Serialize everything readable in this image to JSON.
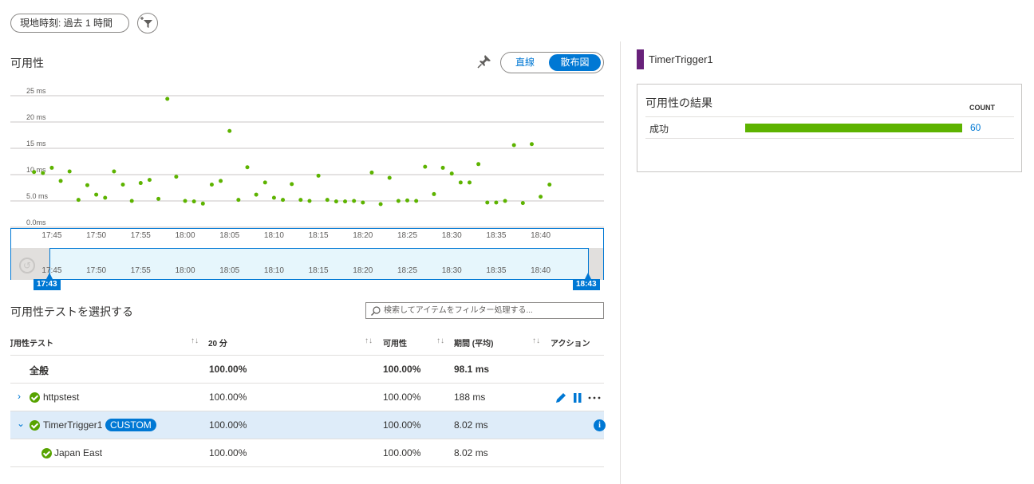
{
  "header": {
    "time_range": "現地時刻: 過去 1 時間",
    "filter_icon": "filter-add-icon"
  },
  "availability": {
    "title": "可用性",
    "pin_icon": "pin-icon",
    "toggle_line": "直線",
    "toggle_scatter": "散布図",
    "selected_view": "散布図"
  },
  "chart_data": {
    "type": "scatter",
    "title": "",
    "xlabel": "",
    "ylabel": "",
    "y_unit": "ms",
    "ylim": [
      0,
      25
    ],
    "y_ticks": [
      "25 ms",
      "20 ms",
      "15 ms",
      "10 ms",
      "5.0 ms",
      "0.0ms"
    ],
    "x_ticks": [
      "17:45",
      "17:50",
      "17:55",
      "18:00",
      "18:05",
      "18:10",
      "18:15",
      "18:20",
      "18:25",
      "18:30",
      "18:35",
      "18:40"
    ],
    "xlim": [
      "17:42",
      "18:44"
    ],
    "grid": true,
    "color": "#5db300",
    "x": [
      "17:43",
      "17:44",
      "17:45",
      "17:46",
      "17:47",
      "17:48",
      "17:49",
      "17:50",
      "17:51",
      "17:52",
      "17:53",
      "17:54",
      "17:55",
      "17:56",
      "17:57",
      "17:58",
      "17:59",
      "18:00",
      "18:01",
      "18:02",
      "18:03",
      "18:04",
      "18:05",
      "18:06",
      "18:07",
      "18:08",
      "18:09",
      "18:10",
      "18:11",
      "18:12",
      "18:13",
      "18:14",
      "18:15",
      "18:16",
      "18:17",
      "18:18",
      "18:19",
      "18:20",
      "18:21",
      "18:22",
      "18:23",
      "18:24",
      "18:25",
      "18:26",
      "18:27",
      "18:28",
      "18:29",
      "18:30",
      "18:31",
      "18:32",
      "18:33",
      "18:34",
      "18:35",
      "18:36",
      "18:37",
      "18:38",
      "18:39",
      "18:40",
      "18:41"
    ],
    "y": [
      10.5,
      10.3,
      11.3,
      8.8,
      10.6,
      5.2,
      8.0,
      6.2,
      5.6,
      10.6,
      8.1,
      5.0,
      8.4,
      9.0,
      5.4,
      24.4,
      9.6,
      5.0,
      4.9,
      4.5,
      8.1,
      8.8,
      18.3,
      5.2,
      11.4,
      6.2,
      8.5,
      5.6,
      5.2,
      8.2,
      5.2,
      5.0,
      9.8,
      5.2,
      4.9,
      4.9,
      5.0,
      4.7,
      10.4,
      4.4,
      9.4,
      5.0,
      5.1,
      5.0,
      11.5,
      6.3,
      11.3,
      10.2,
      8.5,
      8.5,
      12.0,
      4.7,
      4.7,
      5.0,
      15.6,
      4.6,
      15.8,
      5.8,
      8.1
    ]
  },
  "time_brush": {
    "start_label": "17:43",
    "end_label": "18:43",
    "reset_icon": "reset-icon",
    "x_ticks": [
      "17:45",
      "17:50",
      "17:55",
      "18:00",
      "18:05",
      "18:10",
      "18:15",
      "18:20",
      "18:25",
      "18:30",
      "18:35",
      "18:40"
    ]
  },
  "test_select": {
    "title": "可用性テストを選択する",
    "search_placeholder": "検索してアイテムをフィルター処理する...",
    "search_icon": "search-icon"
  },
  "table": {
    "sort_icon": "↑↓",
    "headers": {
      "name": "可用性テスト",
      "last20": "20 分",
      "availability": "可用性",
      "duration": "期間 (平均)",
      "actions": "アクション"
    },
    "overall": {
      "name": "全般",
      "last20": "100.00%",
      "availability": "100.00%",
      "duration": "98.1 ms"
    },
    "rows": [
      {
        "name": "httpstest",
        "last20": "100.00%",
        "availability": "100.00%",
        "duration": "188 ms",
        "expanded": false,
        "status": "success"
      },
      {
        "name": "TimerTrigger1",
        "badge": "CUSTOM",
        "last20": "100.00%",
        "availability": "100.00%",
        "duration": "8.02 ms",
        "expanded": true,
        "selected": true,
        "status": "success"
      },
      {
        "name": "Japan East",
        "last20": "100.00%",
        "availability": "100.00%",
        "duration": "8.02 ms",
        "child": true,
        "status": "success"
      }
    ],
    "action_icons": [
      "edit-icon",
      "pause-icon",
      "more-icon",
      "info-icon"
    ]
  },
  "side_panel": {
    "legend_name": "TimerTrigger1",
    "legend_color": "#68217a",
    "results_title": "可用性の結果",
    "count_header": "COUNT",
    "results": [
      {
        "label": "成功",
        "count": "60",
        "fraction": 1.0,
        "color": "#5db300"
      }
    ]
  }
}
